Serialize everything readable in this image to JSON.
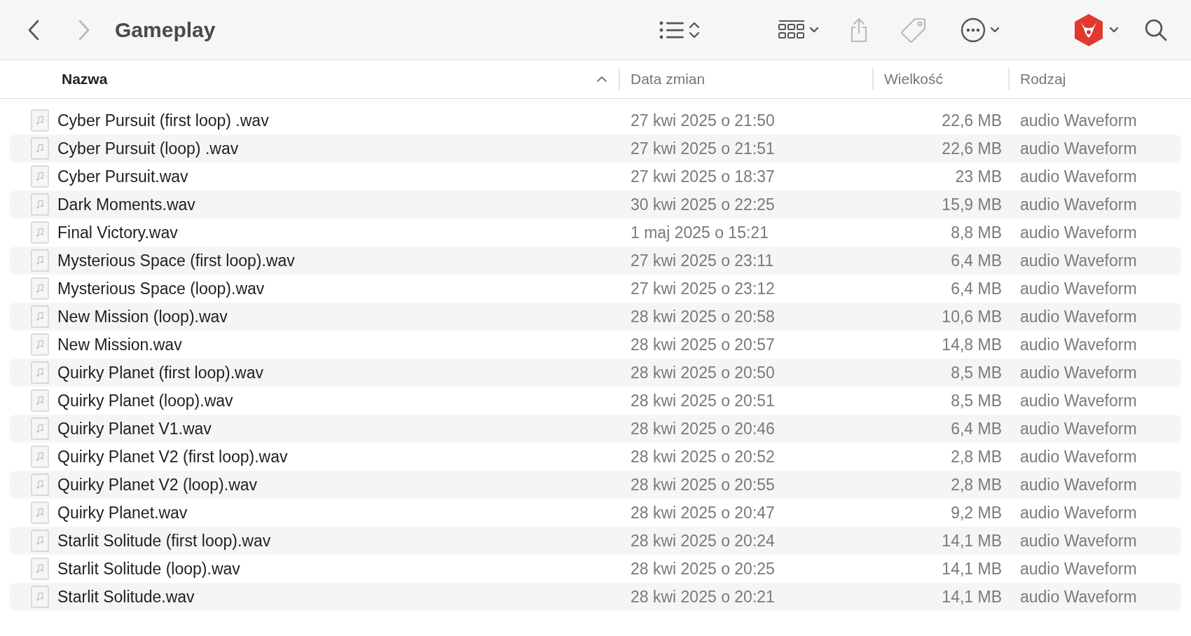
{
  "window": {
    "title": "Gameplay"
  },
  "toolbar_buttons": [
    {
      "kind": "back",
      "disabled": false
    },
    {
      "kind": "forward",
      "disabled": true
    },
    {
      "kind": "list-view",
      "disabled": false
    },
    {
      "kind": "grid-view",
      "disabled": false
    },
    {
      "kind": "share",
      "disabled": true
    },
    {
      "kind": "tag",
      "disabled": true
    },
    {
      "kind": "more",
      "disabled": false
    },
    {
      "kind": "app-logo",
      "disabled": false
    },
    {
      "kind": "search",
      "disabled": false
    }
  ],
  "table": {
    "columns": [
      {
        "label": "Nazwa",
        "sorted": true
      },
      {
        "label": "Data zmian",
        "sorted": false
      },
      {
        "label": "Wielkość",
        "sorted": false
      },
      {
        "label": "Rodzaj",
        "sorted": false
      }
    ],
    "rows": [
      {
        "name": "Cyber Pursuit (first loop) .wav",
        "date": "27 kwi 2025 o 21:50",
        "size": "22,6 MB",
        "kind": "audio Waveform"
      },
      {
        "name": "Cyber Pursuit (loop) .wav",
        "date": "27 kwi 2025 o 21:51",
        "size": "22,6 MB",
        "kind": "audio Waveform"
      },
      {
        "name": "Cyber Pursuit.wav",
        "date": "27 kwi 2025 o 18:37",
        "size": "23 MB",
        "kind": "audio Waveform"
      },
      {
        "name": "Dark Moments.wav",
        "date": "30 kwi 2025 o 22:25",
        "size": "15,9 MB",
        "kind": "audio Waveform"
      },
      {
        "name": "Final Victory.wav",
        "date": "1 maj 2025 o 15:21",
        "size": "8,8 MB",
        "kind": "audio Waveform"
      },
      {
        "name": "Mysterious Space (first loop).wav",
        "date": "27 kwi 2025 o 23:11",
        "size": "6,4 MB",
        "kind": "audio Waveform"
      },
      {
        "name": "Mysterious Space (loop).wav",
        "date": "27 kwi 2025 o 23:12",
        "size": "6,4 MB",
        "kind": "audio Waveform"
      },
      {
        "name": "New Mission (loop).wav",
        "date": "28 kwi 2025 o 20:58",
        "size": "10,6 MB",
        "kind": "audio Waveform"
      },
      {
        "name": "New Mission.wav",
        "date": "28 kwi 2025 o 20:57",
        "size": "14,8 MB",
        "kind": "audio Waveform"
      },
      {
        "name": "Quirky Planet (first loop).wav",
        "date": "28 kwi 2025 o 20:50",
        "size": "8,5 MB",
        "kind": "audio Waveform"
      },
      {
        "name": "Quirky Planet (loop).wav",
        "date": "28 kwi 2025 o 20:51",
        "size": "8,5 MB",
        "kind": "audio Waveform"
      },
      {
        "name": "Quirky Planet V1.wav",
        "date": "28 kwi 2025 o 20:46",
        "size": "6,4 MB",
        "kind": "audio Waveform"
      },
      {
        "name": "Quirky Planet V2 (first loop).wav",
        "date": "28 kwi 2025 o 20:52",
        "size": "2,8 MB",
        "kind": "audio Waveform"
      },
      {
        "name": "Quirky Planet V2 (loop).wav",
        "date": "28 kwi 2025 o 20:55",
        "size": "2,8 MB",
        "kind": "audio Waveform"
      },
      {
        "name": "Quirky Planet.wav",
        "date": "28 kwi 2025 o 20:47",
        "size": "9,2 MB",
        "kind": "audio Waveform"
      },
      {
        "name": "Starlit Solitude (first loop).wav",
        "date": "28 kwi 2025 o 20:24",
        "size": "14,1 MB",
        "kind": "audio Waveform"
      },
      {
        "name": "Starlit Solitude (loop).wav",
        "date": "28 kwi 2025 o 20:25",
        "size": "14,1 MB",
        "kind": "audio Waveform"
      },
      {
        "name": "Starlit Solitude.wav",
        "date": "28 kwi 2025 o 20:21",
        "size": "14,1 MB",
        "kind": "audio Waveform"
      }
    ]
  }
}
